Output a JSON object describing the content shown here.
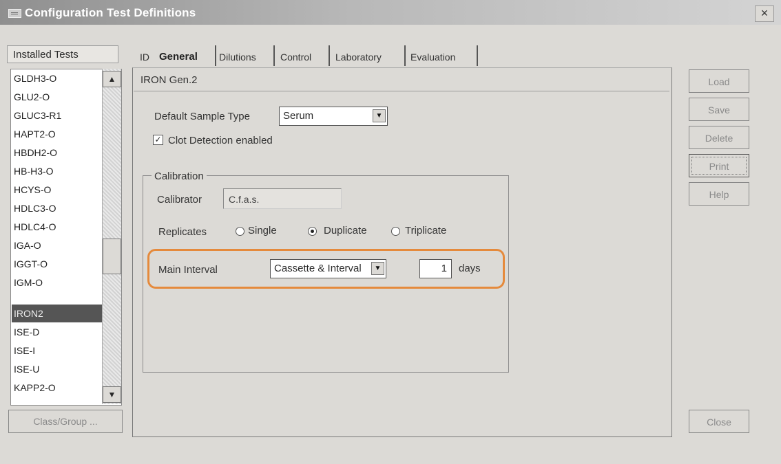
{
  "window": {
    "title": "Configuration Test Definitions",
    "close_glyph": "×"
  },
  "installed_tests": {
    "label": "Installed Tests",
    "items": [
      "GLDH3-O",
      "GLU2-O",
      "GLUC3-R1",
      "HAPT2-O",
      "HBDH2-O",
      "HB-H3-O",
      "HCYS-O",
      "HDLC3-O",
      "HDLC4-O",
      "IGA-O",
      "IGGT-O",
      "IGM-O",
      "IRON2",
      "ISE-D",
      "ISE-I",
      "ISE-U",
      "KAPP2-O"
    ],
    "selected": "IRON2"
  },
  "class_group_button": "Class/Group ...",
  "tabs": [
    "ID",
    "General",
    "Dilutions",
    "Control",
    "Laboratory",
    "Evaluation"
  ],
  "active_tab": "General",
  "panel_title": "IRON Gen.2",
  "default_sample_type": {
    "label": "Default Sample Type",
    "value": "Serum"
  },
  "clot_detection": {
    "label": "Clot Detection enabled",
    "checked": true
  },
  "calibration": {
    "group_label": "Calibration",
    "calibrator_label": "Calibrator",
    "calibrator_value": "C.f.a.s.",
    "replicates_label": "Replicates",
    "replicate_options": [
      "Single",
      "Duplicate",
      "Triplicate"
    ],
    "replicate_selected": "Duplicate",
    "main_interval_label": "Main Interval",
    "main_interval_value": "Cassette & Interval",
    "interval_number": "1",
    "interval_unit": "days"
  },
  "buttons": {
    "load": "Load",
    "save": "Save",
    "delete": "Delete",
    "print": "Print",
    "help": "Help",
    "close": "Close"
  },
  "colors": {
    "highlight": "#e58a3c",
    "selected_item": "#555555"
  },
  "icons": {
    "scroll_up": "▲",
    "scroll_down": "▼",
    "dropdown": "▼",
    "check": "✓"
  }
}
